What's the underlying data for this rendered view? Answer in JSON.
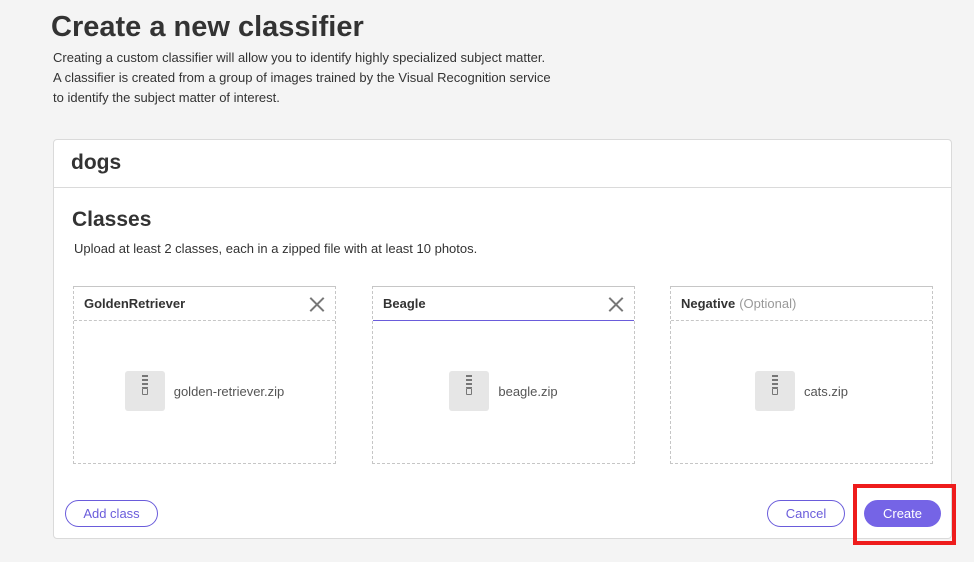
{
  "page": {
    "title": "Create a new classifier",
    "description": "Creating a custom classifier will allow you to identify highly specialized subject matter. A classifier is created from a group of images trained by the Visual Recognition service to identify the subject matter of interest."
  },
  "classifier": {
    "name": "dogs",
    "classes_title": "Classes",
    "classes_description": "Upload at least 2 classes, each in a zipped file with at least 10 photos."
  },
  "classes": [
    {
      "name": "GoldenRetriever",
      "file": "golden-retriever.zip"
    },
    {
      "name": "Beagle",
      "file": "beagle.zip"
    },
    {
      "name": "Negative",
      "optional_label": "(Optional)",
      "file": "cats.zip"
    }
  ],
  "actions": {
    "add_class": "Add class",
    "cancel": "Cancel",
    "create": "Create"
  },
  "colors": {
    "accent": "#7564e6",
    "highlight": "#ee1c1c",
    "background": "#f4f4f4"
  }
}
